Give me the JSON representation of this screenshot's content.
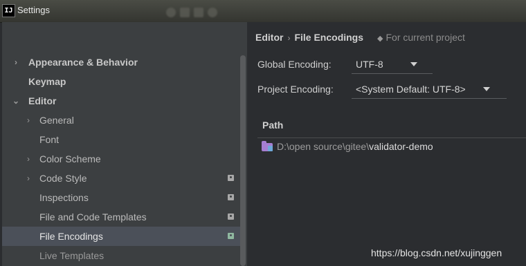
{
  "window": {
    "title": "Settings",
    "app_icon_text": "IJ"
  },
  "sidebar": {
    "items": [
      {
        "label": "Appearance & Behavior",
        "arrow": "›",
        "badge": false
      },
      {
        "label": "Keymap",
        "arrow": "",
        "badge": false
      },
      {
        "label": "Editor",
        "arrow": "⌄",
        "badge": false
      },
      {
        "label": "General",
        "arrow": "›",
        "badge": false
      },
      {
        "label": "Font",
        "arrow": "",
        "badge": false
      },
      {
        "label": "Color Scheme",
        "arrow": "›",
        "badge": false
      },
      {
        "label": "Code Style",
        "arrow": "›",
        "badge": true
      },
      {
        "label": "Inspections",
        "arrow": "",
        "badge": true
      },
      {
        "label": "File and Code Templates",
        "arrow": "",
        "badge": true
      },
      {
        "label": "File Encodings",
        "arrow": "",
        "badge": true
      },
      {
        "label": "Live Templates",
        "arrow": "",
        "badge": false
      }
    ],
    "selected_index": 9
  },
  "breadcrumb": {
    "parent": "Editor",
    "separator": "›",
    "current": "File Encodings",
    "scope_icon": "◆",
    "scope": "For current project"
  },
  "form": {
    "global_label": "Global Encoding:",
    "global_value": "UTF-8",
    "project_label": "Project Encoding:",
    "project_value": "<System Default: UTF-8>"
  },
  "table": {
    "header": "Path",
    "rows": [
      {
        "dim_part": "D:\\open source\\gitee\\",
        "main_part": "validator-demo"
      }
    ]
  },
  "watermark": "https://blog.csdn.net/xujinggen",
  "icons": {
    "folder": "project-folder-icon",
    "badge": "project-settings-badge-icon",
    "expand": "chevron-icon"
  }
}
